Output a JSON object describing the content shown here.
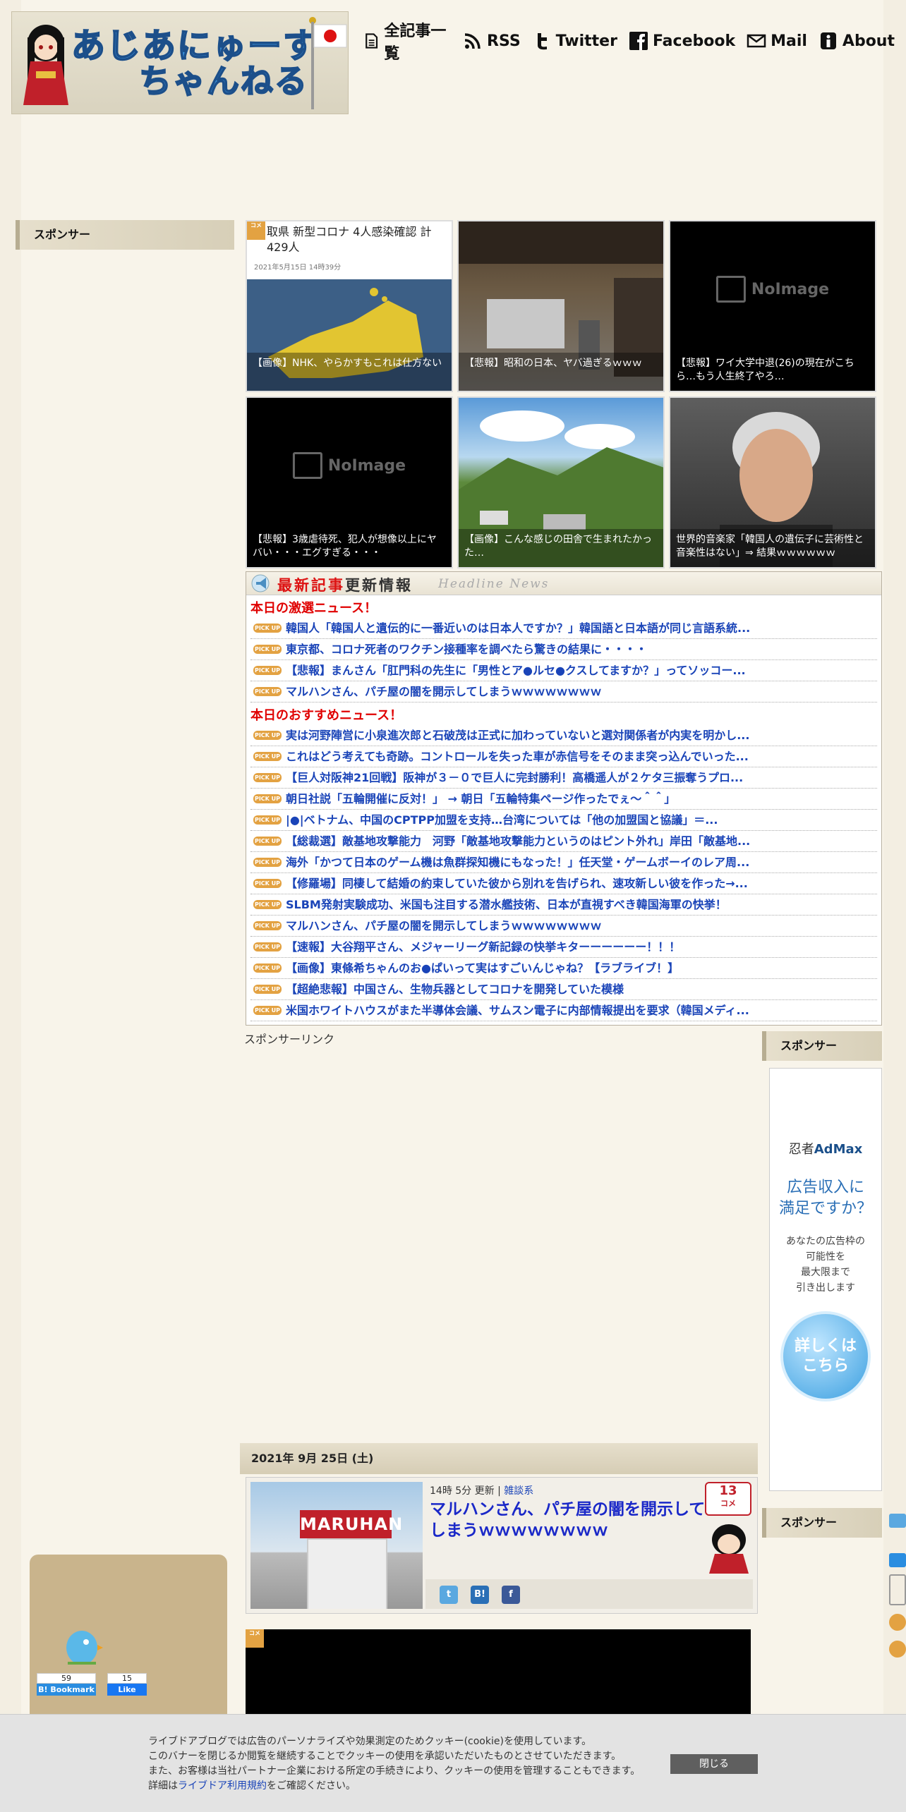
{
  "site": {
    "logo_line1": "あじあにゅーす",
    "logo_line2": "ちゃんねる"
  },
  "nav": [
    {
      "label": "全記事一覧",
      "icon": "document-icon"
    },
    {
      "label": "RSS",
      "icon": "rss-icon"
    },
    {
      "label": "Twitter",
      "icon": "twitter-icon"
    },
    {
      "label": "Facebook",
      "icon": "facebook-icon"
    },
    {
      "label": "Mail",
      "icon": "mail-icon"
    },
    {
      "label": "About",
      "icon": "info-icon"
    }
  ],
  "sidebar_left": {
    "sponsor_heading": "スポンサー"
  },
  "sidebar_right": {
    "sponsor_heading_1": "スポンサー",
    "sponsor_heading_2": "スポンサー"
  },
  "tiles": [
    {
      "caption": "【画像】NHK、やらかすもこれは仕方ない",
      "image": "news-screenshot",
      "overlay_title": "取県 新型コロナ 4人感染確認 計429人",
      "overlay_date": "2021年5月15日 14時39分",
      "badge": "コメ"
    },
    {
      "caption": "【悲報】昭和の日本、ヤバ過ぎるｗｗｗ",
      "image": "street-photo"
    },
    {
      "caption": "【悲報】ワイ大学中退(26)の現在がこちら…もう人生終了やろ…",
      "image": "noimage"
    },
    {
      "caption": "【悲報】3歳虐待死、犯人が想像以上にヤバい・・・エグすぎる・・・",
      "image": "noimage"
    },
    {
      "caption": "【画像】こんな感じの田舎で生まれたかった…",
      "image": "countryside-photo"
    },
    {
      "caption": "世界的音楽家「韓国人の遺伝子に芸術性と音楽性はない」⇒ 結果ｗｗｗｗｗｗ",
      "image": "portrait-photo"
    }
  ],
  "noimage_label": "NoImage",
  "headline": {
    "title_red": "最新記事",
    "title_black": "更新情報",
    "title_en": "Headline News",
    "pick_label": "PICK UP",
    "section1": "本日の激選ニュース！",
    "items1": [
      "韓国人「韓国人と遺伝的に一番近いのは日本人ですか？」韓国語と日本語が同じ言語系統...",
      "東京都、コロナ死者のワクチン接種率を調べたら驚きの結果に・・・・",
      "【悲報】まんさん「肛門科の先生に「男性とア●ルセ●クスしてますか？」ってソッコー...",
      "マルハンさん、パチ屋の闇を開示してしまうｗｗｗｗｗｗｗｗ"
    ],
    "section2": "本日のおすすめニュース！",
    "items2": [
      "実は河野陣営に小泉進次郎と石破茂は正式に加わっていないと選対関係者が内実を明かし...",
      "これはどう考えても奇跡。コントロールを失った車が赤信号をそのまま突っ込んでいった...",
      "【巨人対阪神21回戦】阪神が３－０で巨人に完封勝利！高橋遥人が２ケタ三振奪うプロ...",
      "朝日社説「五輪開催に反対！」 → 朝日「五輪特集ページ作ったでぇ～＾＾」",
      "|●|ベトナム、中国のCPTPP加盟を支持…台湾については「他の加盟国と協議」＝...",
      "【総裁選】敵基地攻撃能力　河野「敵基地攻撃能力というのはピント外れ」岸田「敵基地...",
      "海外「かつて日本のゲーム機は魚群探知機にもなった！」任天堂・ゲームボーイのレア周...",
      "【修羅場】同棲して結婚の約束していた彼から別れを告げられ、速攻新しい彼を作った→...",
      "SLBM発射実験成功、米国も注目する潜水艦技術、日本が直視すべき韓国海軍の快挙！",
      "マルハンさん、パチ屋の闇を開示してしまうｗｗｗｗｗｗｗｗ",
      "【速報】大谷翔平さん、メジャーリーグ新記録の快挙キターーーーーー！！！",
      "【画像】東條希ちゃんのお●ぱいって実はすごいんじゃね？【ラブライブ！】",
      "【超絶悲報】中国さん、生物兵器としてコロナを開発していた模様",
      "米国ホワイトハウスがまた半導体会議、サムスン電子に内部情報提出を要求（韓国メディ..."
    ]
  },
  "sponsor_link": "スポンサーリンク",
  "ad": {
    "brand_prefix": "忍者",
    "brand": "AdMax",
    "headline_line1": "広告収入に",
    "headline_line2": "満足ですか？",
    "body_line1": "あなたの広告枠の",
    "body_line2": "可能性を",
    "body_line3": "最大限まで",
    "body_line4": "引き出します",
    "cta_line1": "詳しくは",
    "cta_line2": "こちら"
  },
  "article": {
    "date": "2021年 9月 25日 (土)",
    "time": "14時 5分 更新",
    "separator": "|",
    "category": "雑談系",
    "title": "マルハンさん、パチ屋の闇を開示してしまうｗｗｗｗｗｗｗｗ",
    "comment_count": "13",
    "comment_label": "コメ",
    "thumb_sign": "MARUHAN"
  },
  "hatena": {
    "bookmark_count": "59",
    "bookmark_label": "B! Bookmark",
    "like_count": "15",
    "like_label": "Like"
  },
  "cookie": {
    "line1": "ライブドアブログでは広告のパーソナライズや効果測定のためクッキー(cookie)を使用しています。",
    "line2": "このバナーを閉じるか閲覧を継続することでクッキーの使用を承認いただいたものとさせていただきます。",
    "line3": "また、お客様は当社パートナー企業における所定の手続きにより、クッキーの使用を管理することもできます。",
    "line4_prefix": "詳細は",
    "line4_link": "ライブドア利用規約",
    "line4_suffix": "をご確認ください。",
    "close_label": "閉じる"
  },
  "colors": {
    "headline_red": "#e00000",
    "link_blue": "#1a44b8",
    "pickup_orange": "#e3a242",
    "page_bg": "#f3eee2"
  }
}
